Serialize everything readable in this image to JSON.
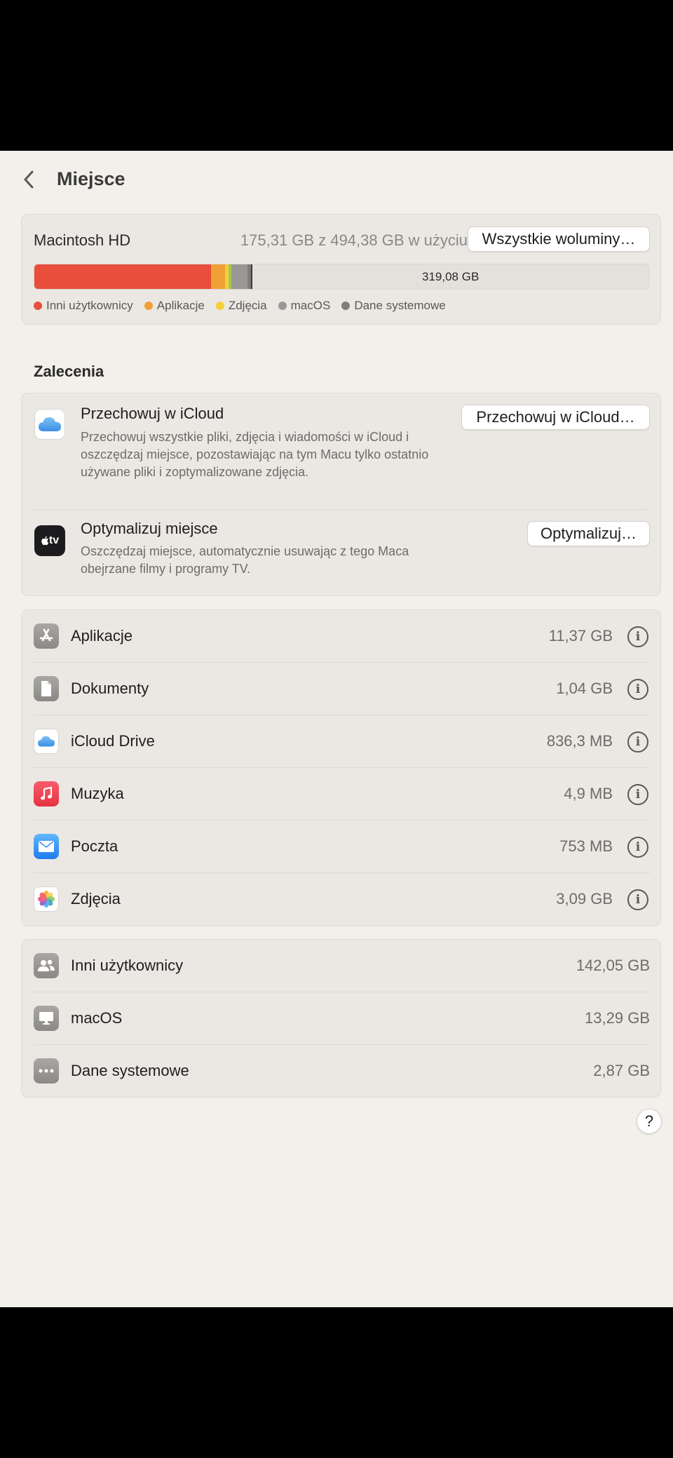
{
  "header": {
    "title": "Miejsce"
  },
  "storage": {
    "disk_name": "Macintosh HD",
    "usage": "175,31 GB z 494,38 GB w użyciu",
    "volumes_button": "Wszystkie woluminy…",
    "free_label": "319,08 GB",
    "total_gb": 494.38,
    "segments": [
      {
        "name": "others",
        "gb": 142.05,
        "color": "#e94e3d"
      },
      {
        "name": "apps",
        "gb": 11.37,
        "color": "#f0a035"
      },
      {
        "name": "photos",
        "gb": 3.09,
        "color": "#f5cf3b"
      },
      {
        "name": "docs",
        "gb": 1.9,
        "color": "#a4c84a"
      },
      {
        "name": "macos",
        "gb": 13.29,
        "color": "#9a9895"
      },
      {
        "name": "system",
        "gb": 2.87,
        "color": "#7f7d7a"
      }
    ],
    "legend": [
      {
        "label": "Inni użytkownicy",
        "color": "#e94e3d"
      },
      {
        "label": "Aplikacje",
        "color": "#f0a035"
      },
      {
        "label": "Zdjęcia",
        "color": "#f5cf3b"
      },
      {
        "label": "macOS",
        "color": "#9a9895"
      },
      {
        "label": "Dane systemowe",
        "color": "#7f7d7a"
      }
    ]
  },
  "recommendations": {
    "title": "Zalecenia",
    "icloud": {
      "title": "Przechowuj w iCloud",
      "description": "Przechowuj wszystkie pliki, zdjęcia i wiadomości w iCloud i oszczędzaj miejsce, pozostawiając na tym Macu tylko ostatnio używane pliki i zoptymalizowane zdjęcia.",
      "button": "Przechowuj w iCloud…"
    },
    "optimize": {
      "title": "Optymalizuj miejsce",
      "description": "Oszczędzaj miejsce, automatycznie usuwając z tego Maca obejrzane filmy i programy TV.",
      "button": "Optymalizuj…",
      "icon_text": "tv"
    }
  },
  "categories": [
    {
      "label": "Aplikacje",
      "size": "11,37 GB",
      "icon": "app-store-icon"
    },
    {
      "label": "Dokumenty",
      "size": "1,04 GB",
      "icon": "document-icon"
    },
    {
      "label": "iCloud Drive",
      "size": "836,3 MB",
      "icon": "icloud-icon"
    },
    {
      "label": "Muzyka",
      "size": "4,9 MB",
      "icon": "music-icon"
    },
    {
      "label": "Poczta",
      "size": "753 MB",
      "icon": "mail-icon"
    },
    {
      "label": "Zdjęcia",
      "size": "3,09 GB",
      "icon": "photos-icon"
    }
  ],
  "system_items": [
    {
      "label": "Inni użytkownicy",
      "size": "142,05 GB",
      "icon": "users-icon"
    },
    {
      "label": "macOS",
      "size": "13,29 GB",
      "icon": "display-icon"
    },
    {
      "label": "Dane systemowe",
      "size": "2,87 GB",
      "icon": "ellipsis-icon"
    }
  ],
  "help_label": "?"
}
